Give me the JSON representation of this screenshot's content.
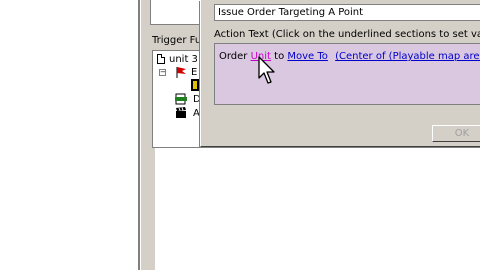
{
  "trigger_panel": {
    "header": "Trigger Fu",
    "tree": [
      {
        "label": "unit 3",
        "icon": "document-icon"
      },
      {
        "label": "E",
        "icon": "red-flag-icon"
      },
      {
        "label": "",
        "icon": "yellow-square-icon"
      },
      {
        "label": "D",
        "icon": "green-condition-icon"
      },
      {
        "label": "A",
        "icon": "clapperboard-icon"
      }
    ]
  },
  "dialog": {
    "action_type": "Issue Order Targeting A Point",
    "action_text_label": "Action Text (Click on the underlined sections to set values",
    "action_text": {
      "prefix": "Order",
      "unit": "Unit",
      "middle": "to",
      "order": "Move To",
      "target": "(Center of (Playable map area))"
    },
    "ok_label": "OK"
  },
  "colors": {
    "action_box": "#d9c8e0",
    "link": "#0000cc",
    "unit_link": "#cc00cc"
  }
}
